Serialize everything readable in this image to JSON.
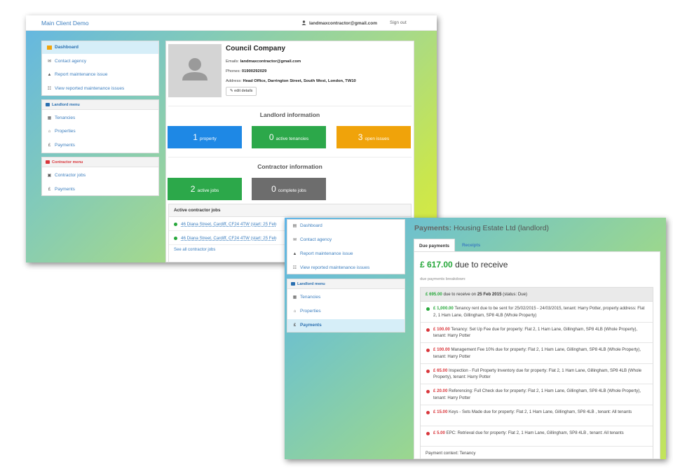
{
  "back_window": {
    "header": {
      "brand": "Main Client Demo",
      "user_email": "landmaxcontractor@gmail.com",
      "sign_out": "Sign out"
    },
    "nav_main": [
      {
        "label": "Dashboard",
        "icon": "dashboard-icon"
      },
      {
        "label": "Contact agency",
        "icon": "envelope-icon"
      },
      {
        "label": "Report maintenance issue",
        "icon": "warning-icon"
      },
      {
        "label": "View reported maintenance issues",
        "icon": "list-icon"
      }
    ],
    "landlord_menu": {
      "title": "Landlord menu",
      "items": [
        {
          "label": "Tenancies",
          "icon": "calendar-icon"
        },
        {
          "label": "Properties",
          "icon": "home-icon"
        },
        {
          "label": "Payments",
          "icon": "pound-icon"
        }
      ]
    },
    "contractor_menu": {
      "title": "Contractor menu",
      "items": [
        {
          "label": "Contractor jobs",
          "icon": "briefcase-icon"
        },
        {
          "label": "Payments",
          "icon": "pound-icon"
        }
      ]
    },
    "profile": {
      "company": "Council Company",
      "emails_label": "Emails:",
      "emails": "landmaxcontractor@gmail.com",
      "phones_label": "Phones:",
      "phones": "01900292029",
      "address_label": "Address:",
      "address": "Head Office, Darrington Street, South West, London, TW10",
      "edit_label": "edit details"
    },
    "landlord_info": {
      "title": "Landlord information",
      "stats": [
        {
          "num": "1",
          "label": "property",
          "color": "#1e88e5"
        },
        {
          "num": "0",
          "label": "active tenancies",
          "color": "#2ca84a"
        },
        {
          "num": "3",
          "label": "open issues",
          "color": "#f0a30a"
        }
      ]
    },
    "contractor_info": {
      "title": "Contractor information",
      "stats": [
        {
          "num": "2",
          "label": "active jobs",
          "color": "#2ca84a"
        },
        {
          "num": "0",
          "label": "complete jobs",
          "color": "#6d6d6d"
        }
      ]
    },
    "active_jobs": {
      "title": "Active contractor jobs",
      "rows": [
        "46 Diana Street, Cardiff, CF24 4TW (start: 25 Feb",
        "46 Diana Street, Cardiff, CF24 4TW (start: 25 Feb"
      ],
      "see_all": "See all contractor jobs"
    }
  },
  "front_window": {
    "nav_main": [
      {
        "label": "Dashboard",
        "icon": "dashboard-icon"
      },
      {
        "label": "Contact agency",
        "icon": "envelope-icon"
      },
      {
        "label": "Report maintenance issue",
        "icon": "warning-icon"
      },
      {
        "label": "View reported maintenance issues",
        "icon": "list-icon"
      }
    ],
    "landlord_menu": {
      "title": "Landlord menu",
      "items": [
        {
          "label": "Tenancies",
          "icon": "calendar-icon"
        },
        {
          "label": "Properties",
          "icon": "home-icon"
        },
        {
          "label": "Payments",
          "icon": "pound-icon"
        }
      ]
    },
    "payments": {
      "title_bold": "Payments:",
      "title_rest": "Housing Estate Ltd (landlord)",
      "tabs": [
        "Due payments",
        "Receipts"
      ],
      "total_amount": "£ 617.00",
      "total_suffix": "due to receive",
      "breakdown_label": "due payments breakdown:",
      "group": {
        "amount": "£ 695.00",
        "text": "due to receive on",
        "date": "25 Feb 2015",
        "status": "(status: Due)"
      },
      "items": [
        {
          "amount": "£ 1,000.00",
          "text": "Tenancy rent due to be sent for 25/02/2015 - 24/03/2015, tenant: Harry Potter, property address: Flat 2, 1 Ham Lane, Gillingham, SP8 4LB (Whole Property)",
          "status_color": "#27a83b"
        },
        {
          "amount": "£ 100.00",
          "text": "Tenancy: Set Up Fee due for property: Flat 2, 1 Ham Lane, Gillingham, SP8 4LB (Whole Property), tenant: Harry Potter",
          "status_color": "#d9353a"
        },
        {
          "amount": "£ 100.00",
          "text": "Management Fee 10% due for property: Flat 2, 1 Ham Lane, Gillingham, SP8 4LB (Whole Property), tenant: Harry Potter",
          "status_color": "#d9353a"
        },
        {
          "amount": "£ 65.00",
          "text": "Inspection - Full Property Inventory due for property: Flat 2, 1 Ham Lane, Gillingham, SP8 4LB (Whole Property), tenant: Harry Potter",
          "status_color": "#d9353a"
        },
        {
          "amount": "£ 20.00",
          "text": "Referencing: Full Check due for property: Flat 2, 1 Ham Lane, Gillingham, SP8 4LB (Whole Property), tenant: Harry Potter",
          "status_color": "#d9353a"
        },
        {
          "amount": "£ 15.00",
          "text": "Keys - Sets Made due for property: Flat 2, 1 Ham Lane, Gillingham, SP8 4LB , tenant: All tenants",
          "status_color": "#d9353a"
        },
        {
          "amount": "£ 5.00",
          "text": "EPC: Retrieval due for property: Flat 2, 1 Ham Lane, Gillingham, SP8 4LB , tenant: All tenants",
          "status_color": "#d9353a"
        }
      ],
      "context": "Payment context: Tenancy"
    }
  }
}
